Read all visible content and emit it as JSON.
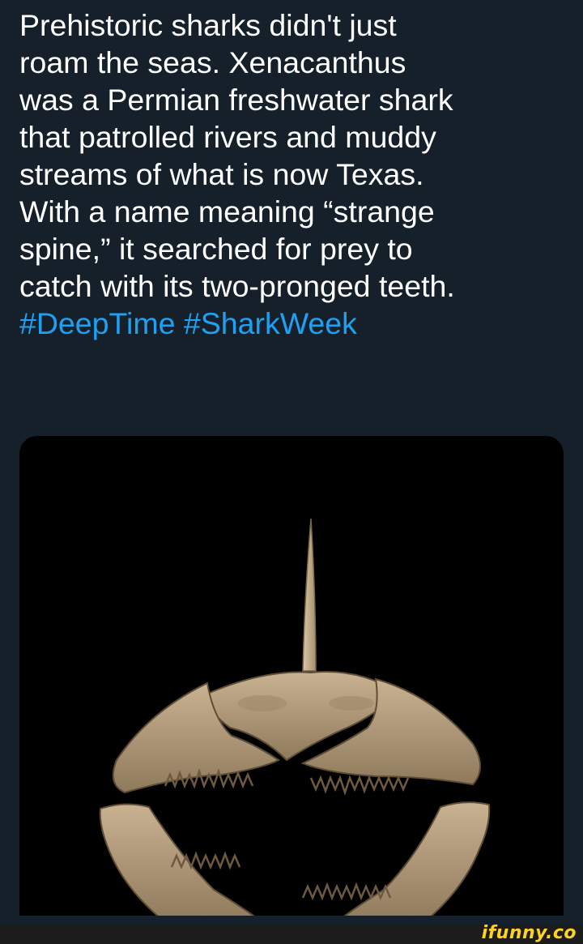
{
  "tweet": {
    "lines": [
      "Prehistoric sharks didn't just",
      "roam the seas. Xenacanthus",
      "was a Permian freshwater shark",
      "that patrolled rivers and muddy",
      "streams of what is now Texas.",
      "With a name meaning “strange",
      "spine,” it searched for prey to",
      "catch with its two-pronged teeth."
    ],
    "hashtags": [
      "#DeepTime",
      "#SharkWeek"
    ]
  },
  "media": {
    "subject": "xenacanthus-skull-fossil"
  },
  "watermark": {
    "text": "ifunny.co"
  },
  "colors": {
    "background": "#15202b",
    "text": "#ffffff",
    "hashtag": "#1da1f2",
    "media_bg": "#000000",
    "bone": "#b59d7c",
    "watermark": "#ffd21f"
  }
}
